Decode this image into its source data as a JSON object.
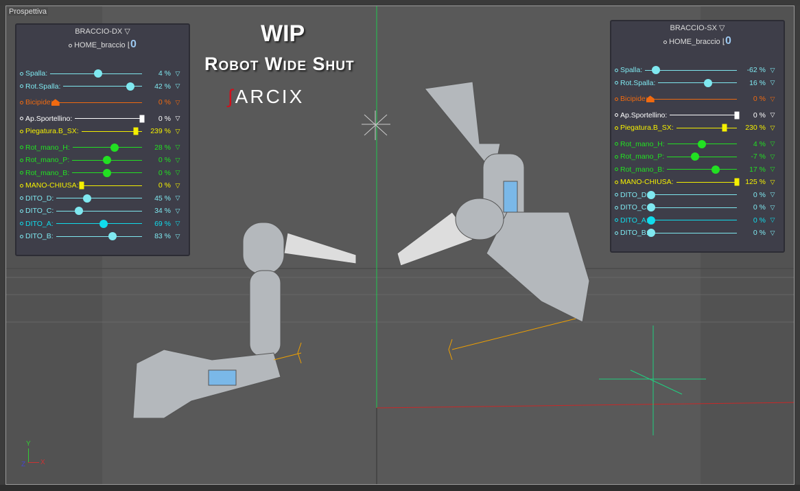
{
  "viewport": {
    "label": "Prospettiva"
  },
  "title": {
    "wip": "WIP",
    "subtitle": "Robot Wide Shut",
    "logo": "SARCIX"
  },
  "axis": {
    "y": "Y",
    "x": "X",
    "z": "Z"
  },
  "colors": {
    "cyan": "#7fe8f0",
    "cyan_bright": "#10dcec",
    "orange": "#f06a10",
    "white": "#ffffff",
    "yellow": "#f5f000",
    "green": "#22e022"
  },
  "panels": [
    {
      "title": "BRACCIO-DX",
      "home": "HOME_braccio",
      "home_value": "0",
      "rows": [
        {
          "label": "Spalla:",
          "value": "4 %",
          "color": "cyan",
          "handle": "circ",
          "level": 0.52
        },
        {
          "label": "Rot.Spalla:",
          "value": "42 %",
          "color": "cyan",
          "handle": "circ",
          "level": 0.85
        },
        {
          "label": "Bicipide:",
          "value": "0 %",
          "color": "orange",
          "handle": "tri",
          "level": 0,
          "gap": true
        },
        {
          "label": "Ap.Sportellino:",
          "value": "0 %",
          "color": "white",
          "handle": "sq",
          "level": 1,
          "gap": true
        },
        {
          "label": "Piegatura.B_SX:",
          "value": "239 %",
          "color": "yellow",
          "handle": "sq",
          "level": 0.9
        },
        {
          "label": "Rot_mano_H:",
          "value": "28 %",
          "color": "green",
          "handle": "circ",
          "level": 0.6,
          "gap": true
        },
        {
          "label": "Rot_mano_P:",
          "value": "0 %",
          "color": "green",
          "handle": "circ",
          "level": 0.5
        },
        {
          "label": "Rot_mano_B:",
          "value": "0 %",
          "color": "green",
          "handle": "circ",
          "level": 0.5
        },
        {
          "label": "MANO-CHIUSA:",
          "value": "0 %",
          "color": "yellow",
          "handle": "sq",
          "level": 0
        },
        {
          "label": "DITO_D:",
          "value": "45 %",
          "color": "cyan",
          "handle": "circ",
          "level": 0.36
        },
        {
          "label": "DITO_C:",
          "value": "34 %",
          "color": "cyan",
          "handle": "circ",
          "level": 0.26
        },
        {
          "label": "DITO_A:",
          "value": "69 %",
          "color": "cyan_bright",
          "handle": "circ",
          "level": 0.55
        },
        {
          "label": "DITO_B:",
          "value": "83 %",
          "color": "cyan",
          "handle": "circ",
          "level": 0.66
        }
      ]
    },
    {
      "title": "BRACCIO-SX",
      "home": "HOME_braccio",
      "home_value": "0",
      "rows": [
        {
          "label": "Spalla:",
          "value": "-62 %",
          "color": "cyan",
          "handle": "circ",
          "level": 0.12
        },
        {
          "label": "Rot.Spalla:",
          "value": "16 %",
          "color": "cyan",
          "handle": "circ",
          "level": 0.63
        },
        {
          "label": "Bicipide:",
          "value": "0 %",
          "color": "orange",
          "handle": "tri",
          "level": 0,
          "gap": true
        },
        {
          "label": "Ap.Sportellino:",
          "value": "0 %",
          "color": "white",
          "handle": "sq",
          "level": 1,
          "gap": true
        },
        {
          "label": "Piegatura.B_SX:",
          "value": "230 %",
          "color": "yellow",
          "handle": "sq",
          "level": 0.8
        },
        {
          "label": "Rot_mano_H:",
          "value": "4 %",
          "color": "green",
          "handle": "circ",
          "level": 0.5,
          "gap": true
        },
        {
          "label": "Rot_mano_P:",
          "value": "-7 %",
          "color": "green",
          "handle": "circ",
          "level": 0.4
        },
        {
          "label": "Rot_mano_B:",
          "value": "17 %",
          "color": "green",
          "handle": "circ",
          "level": 0.7
        },
        {
          "label": "MANO-CHIUSA:",
          "value": "125 %",
          "color": "yellow",
          "handle": "sq",
          "level": 1
        },
        {
          "label": "DITO_D:",
          "value": "0 %",
          "color": "cyan",
          "handle": "circ",
          "level": 0
        },
        {
          "label": "DITO_C:",
          "value": "0 %",
          "color": "cyan",
          "handle": "circ",
          "level": 0
        },
        {
          "label": "DITO_A:",
          "value": "0 %",
          "color": "cyan_bright",
          "handle": "circ",
          "level": 0
        },
        {
          "label": "DITO_B:",
          "value": "0 %",
          "color": "cyan",
          "handle": "circ",
          "level": 0
        }
      ]
    }
  ]
}
